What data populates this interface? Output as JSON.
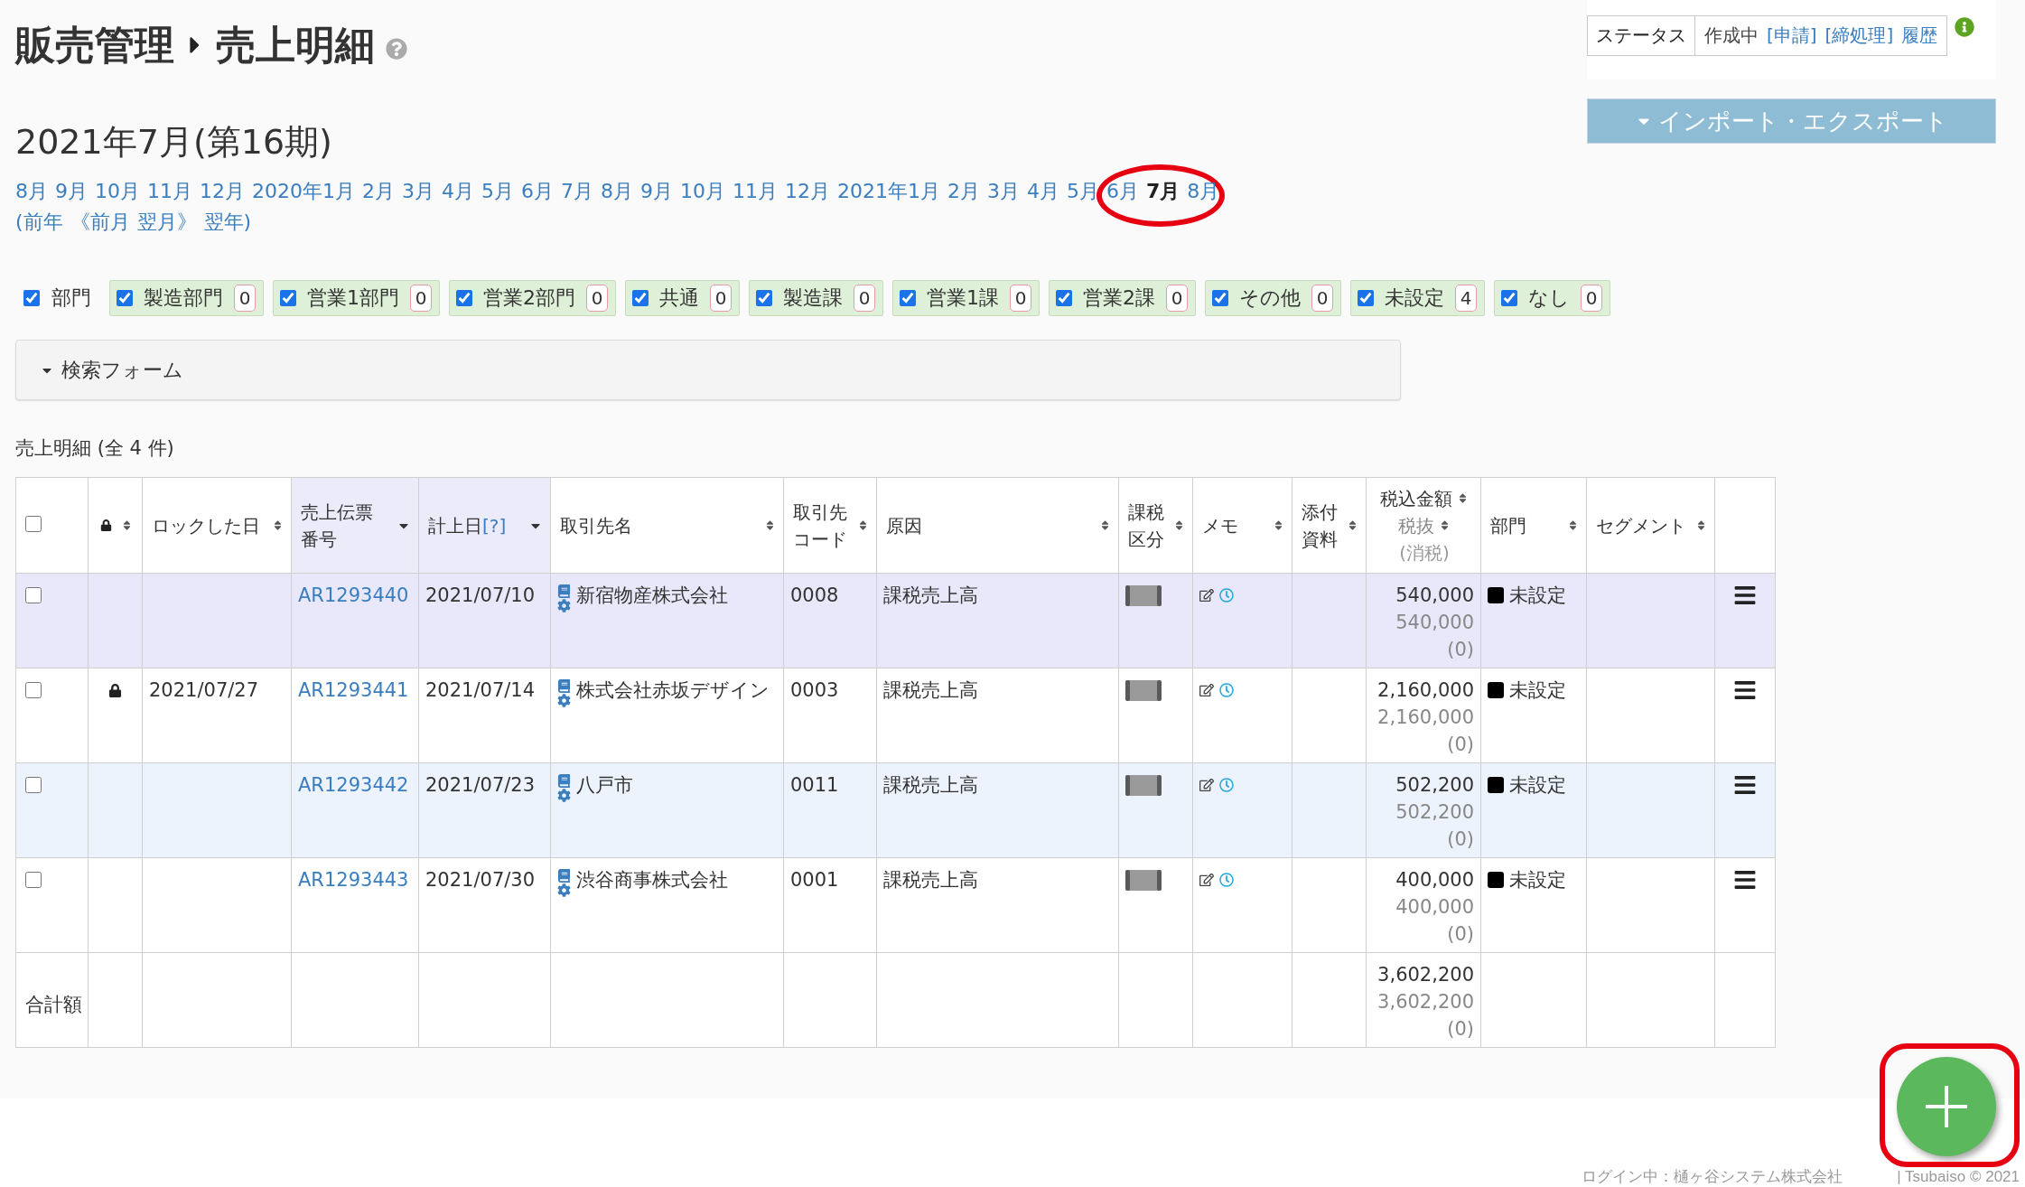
{
  "breadcrumb": {
    "parent": "販売管理",
    "current": "売上明細"
  },
  "status_panel": {
    "label": "ステータス",
    "value": "作成中",
    "links": [
      "[申請]",
      "[締処理]",
      "履歴"
    ]
  },
  "export_button": {
    "label": "インポート・エクスポート"
  },
  "period": {
    "title": "2021年7月(第16期)",
    "circle_selected": true,
    "months": [
      {
        "label": "8月",
        "selected": false
      },
      {
        "label": "9月",
        "selected": false
      },
      {
        "label": "10月",
        "selected": false
      },
      {
        "label": "11月",
        "selected": false
      },
      {
        "label": "12月",
        "selected": false
      },
      {
        "label": "2020年1月",
        "selected": false
      },
      {
        "label": "2月",
        "selected": false
      },
      {
        "label": "3月",
        "selected": false
      },
      {
        "label": "4月",
        "selected": false
      },
      {
        "label": "5月",
        "selected": false
      },
      {
        "label": "6月",
        "selected": false
      },
      {
        "label": "7月",
        "selected": false
      },
      {
        "label": "8月",
        "selected": false
      },
      {
        "label": "9月",
        "selected": false
      },
      {
        "label": "10月",
        "selected": false
      },
      {
        "label": "11月",
        "selected": false
      },
      {
        "label": "12月",
        "selected": false
      },
      {
        "label": "2021年1月",
        "selected": false
      },
      {
        "label": "2月",
        "selected": false
      },
      {
        "label": "3月",
        "selected": false
      },
      {
        "label": "4月",
        "selected": false
      },
      {
        "label": "5月",
        "selected": false
      },
      {
        "label": "6月",
        "selected": false
      },
      {
        "label": "7月",
        "selected": true
      },
      {
        "label": "8月",
        "selected": false
      }
    ],
    "nav": [
      "(前年",
      "《前月",
      "翌月》",
      "翌年)"
    ]
  },
  "department_filter": {
    "label": "部門",
    "checked": true,
    "options": [
      {
        "label": "製造部門",
        "checked": true,
        "count": "0"
      },
      {
        "label": "営業1部門",
        "checked": true,
        "count": "0"
      },
      {
        "label": "営業2部門",
        "checked": true,
        "count": "0"
      },
      {
        "label": "共通",
        "checked": true,
        "count": "0"
      },
      {
        "label": "製造課",
        "checked": true,
        "count": "0"
      },
      {
        "label": "営業1課",
        "checked": true,
        "count": "0"
      },
      {
        "label": "営業2課",
        "checked": true,
        "count": "0"
      },
      {
        "label": "その他",
        "checked": true,
        "count": "0"
      },
      {
        "label": "未設定",
        "checked": true,
        "count": "4"
      },
      {
        "label": "なし",
        "checked": true,
        "count": "0"
      }
    ]
  },
  "search_form": {
    "label": "検索フォーム"
  },
  "table": {
    "caption": "売上明細 (全 4 件)",
    "columns": [
      {
        "kind": "checkbox",
        "checked": false
      },
      {
        "kind": "lock",
        "sorted": false
      },
      {
        "kind": "text",
        "label": "ロックした日",
        "sorted": false
      },
      {
        "kind": "text",
        "label": "売上伝票番号",
        "sorted": true
      },
      {
        "kind": "text",
        "label": "計上日",
        "help": "[?]",
        "sorted": true
      },
      {
        "kind": "text",
        "label": "取引先名",
        "sorted": false
      },
      {
        "kind": "text",
        "label": "取引先コード",
        "sorted": false
      },
      {
        "kind": "text",
        "label": "原因",
        "sorted": false
      },
      {
        "kind": "text",
        "label": "課税区分",
        "sorted": false
      },
      {
        "kind": "text",
        "label": "メモ",
        "sorted": false
      },
      {
        "kind": "text",
        "label": "添付資料",
        "sorted": false
      },
      {
        "kind": "amount",
        "label": "税込金額",
        "sorted": false,
        "sub_label": "税抜",
        "sub_sorted": false,
        "note": "(消税)"
      },
      {
        "kind": "text",
        "label": "部門",
        "sorted": false
      },
      {
        "kind": "text",
        "label": "セグメント",
        "sorted": false
      },
      {
        "kind": "menu"
      }
    ],
    "rows": [
      {
        "checked": false,
        "highlighted": true,
        "locked": false,
        "slip_no": "AR1293440",
        "date": "2021/07/10",
        "customer": "新宿物産株式会社",
        "code": "0008",
        "reason": "課税売上高",
        "amount": "540,000",
        "net": "540,000",
        "tax": "(0)",
        "department": {
          "label": "未設定",
          "color": "#000000"
        }
      },
      {
        "checked": false,
        "highlighted": false,
        "locked": true,
        "lock_date": "2021/07/27",
        "slip_no": "AR1293441",
        "date": "2021/07/14",
        "customer": "株式会社赤坂デザイン",
        "code": "0003",
        "reason": "課税売上高",
        "amount": "2,160,000",
        "net": "2,160,000",
        "tax": "(0)",
        "department": {
          "label": "未設定",
          "color": "#000000"
        }
      },
      {
        "checked": false,
        "highlighted": false,
        "locked": false,
        "slip_no": "AR1293442",
        "date": "2021/07/23",
        "customer": "八戸市",
        "code": "0011",
        "reason": "課税売上高",
        "amount": "502,200",
        "net": "502,200",
        "tax": "(0)",
        "department": {
          "label": "未設定",
          "color": "#000000"
        }
      },
      {
        "checked": false,
        "highlighted": false,
        "locked": false,
        "slip_no": "AR1293443",
        "date": "2021/07/30",
        "customer": "渋谷商事株式会社",
        "code": "0001",
        "reason": "課税売上高",
        "amount": "400,000",
        "net": "400,000",
        "tax": "(0)",
        "department": {
          "label": "未設定",
          "color": "#000000"
        }
      }
    ],
    "total": {
      "label": "合計額",
      "amount": "3,602,200",
      "net": "3,602,200",
      "tax": "(0)"
    }
  },
  "add_button": {
    "framed": true
  },
  "footer": {
    "login": "ログイン中：樋ヶ谷システム株式会社",
    "copyright": "| Tsubaiso © 2021"
  }
}
